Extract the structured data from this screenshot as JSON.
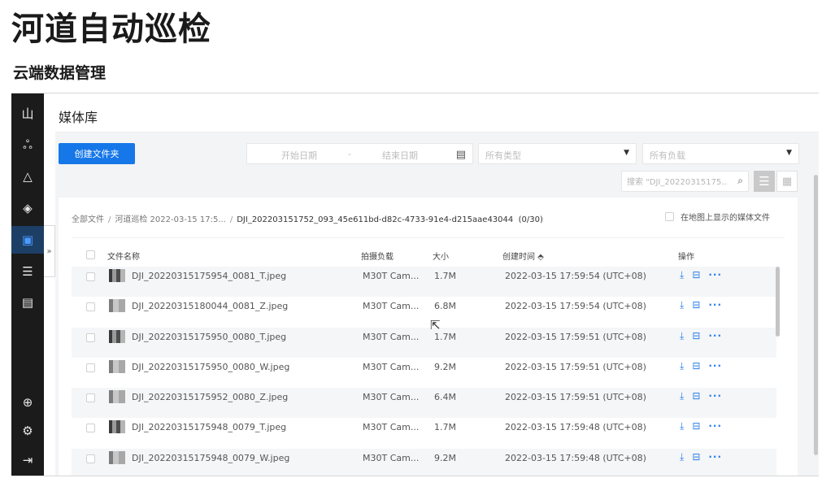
{
  "hero": {
    "title": "河道自动巡检",
    "subtitle": "云端数据管理"
  },
  "sidebar": {
    "items": [
      {
        "icon": "dashboard-icon",
        "glyph": "山"
      },
      {
        "icon": "team-icon",
        "glyph": "ஃ"
      },
      {
        "icon": "map-mountain-icon",
        "glyph": "△"
      },
      {
        "icon": "layers-icon",
        "glyph": "◈"
      },
      {
        "icon": "media-library-icon",
        "glyph": "▣",
        "active": true
      },
      {
        "icon": "task-list-icon",
        "glyph": "☰"
      },
      {
        "icon": "calendar-icon",
        "glyph": "▤"
      },
      {
        "icon": "globe-icon",
        "glyph": "⊕"
      },
      {
        "icon": "device-settings-icon",
        "glyph": "⚙"
      },
      {
        "icon": "logout-icon",
        "glyph": "⇥"
      }
    ],
    "collapse": "»"
  },
  "header": {
    "title": "媒体库"
  },
  "toolbar": {
    "create_folder": "创建文件夹",
    "start_date": "开始日期",
    "range_sep": "-",
    "end_date": "结束日期",
    "type_placeholder": "所有类型",
    "payload_placeholder": "所有负载",
    "search_placeholder": "搜索 \"DJI_20220315175...",
    "view_list": "☰",
    "view_grid": "▦"
  },
  "breadcrumb": {
    "root": "全部文件",
    "folder": "河道巡检 2022-03-15 17:5...",
    "current": "DJI_202203151752_093_45e611bd-d82c-4733-91e4-d215aae43044",
    "count": "(0/30)",
    "sep": "/"
  },
  "map_option": "在地图上显示的媒体文件",
  "table": {
    "headers": {
      "name": "文件名称",
      "payload": "拍摄负载",
      "size": "大小",
      "created": "创建时间 ⬘",
      "actions": "操作"
    },
    "rows": [
      {
        "name": "DJI_20220315175954_0081_T.jpeg",
        "payload": "M30T Cam...",
        "size": "1.7M",
        "created": "2022-03-15 17:59:54 (UTC+08)",
        "thumb": "dark"
      },
      {
        "name": "DJI_20220315180044_0081_Z.jpeg",
        "payload": "M30T Cam...",
        "size": "6.8M",
        "created": "2022-03-15 17:59:54 (UTC+08)",
        "thumb": "light"
      },
      {
        "name": "DJI_20220315175950_0080_T.jpeg",
        "payload": "M30T Cam...",
        "size": "1.7M",
        "created": "2022-03-15 17:59:51 (UTC+08)",
        "thumb": "dark"
      },
      {
        "name": "DJI_20220315175950_0080_W.jpeg",
        "payload": "M30T Cam...",
        "size": "9.2M",
        "created": "2022-03-15 17:59:51 (UTC+08)",
        "thumb": "light"
      },
      {
        "name": "DJI_20220315175952_0080_Z.jpeg",
        "payload": "M30T Cam...",
        "size": "6.4M",
        "created": "2022-03-15 17:59:51 (UTC+08)",
        "thumb": "light"
      },
      {
        "name": "DJI_20220315175948_0079_T.jpeg",
        "payload": "M30T Cam...",
        "size": "1.7M",
        "created": "2022-03-15 17:59:48 (UTC+08)",
        "thumb": "dark"
      },
      {
        "name": "DJI_20220315175948_0079_W.jpeg",
        "payload": "M30T Cam...",
        "size": "9.2M",
        "created": "2022-03-15 17:59:48 (UTC+08)",
        "thumb": "light"
      }
    ],
    "row_actions": {
      "download": "⤓",
      "save": "⊟",
      "more": "···"
    }
  }
}
